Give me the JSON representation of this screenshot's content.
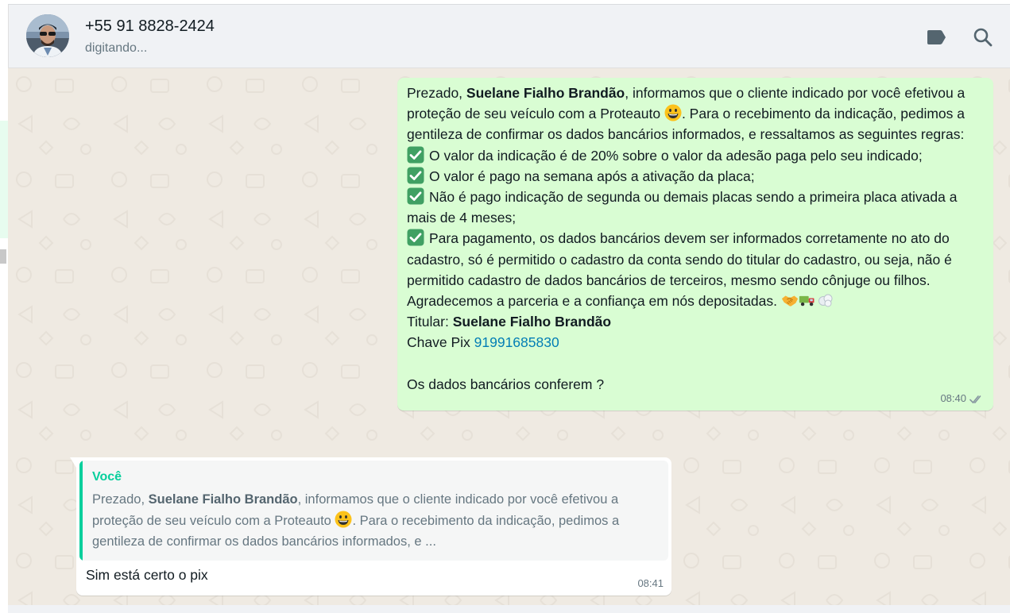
{
  "header": {
    "contact_name": "+55 91 8828-2424",
    "status": "digitando...",
    "icons": [
      "label-icon",
      "search-icon"
    ]
  },
  "colors": {
    "header_bg": "#f0f2f5",
    "chat_bg": "#efeae2",
    "outgoing_bubble": "#d9fdd3",
    "incoming_bubble": "#ffffff",
    "quote_accent": "#06cf9c",
    "link": "#027eb5",
    "read_ticks": "#8696a0"
  },
  "outgoing_message": {
    "intro_prefix": "Prezado, ",
    "intro_name": "Suelane Fialho Brandão",
    "intro_mid": ", informamos que o cliente indicado por você efetivou a proteção de seu veículo com a Proteauto ",
    "intro_suffix": ". Para o recebimento da indicação, pedimos a gentileza de confirmar os dados bancários informados, e ressaltamos as seguintes regras:",
    "rules": [
      "O valor da indicação é de 20% sobre o valor da adesão paga pelo seu indicado;",
      "O valor é pago na semana após a ativação da placa;",
      "Não é pago indicação de segunda ou demais placas sendo a primeira placa ativada a mais de 4 meses;",
      "Para pagamento, os dados bancários devem ser informados corretamente no ato do cadastro, só é permitido o cadastro da conta sendo do titular do cadastro, ou seja, não é permitido cadastro de dados bancários de terceiros, mesmo sendo cônjuge ou filhos."
    ],
    "thanks": "Agradecemos a parceria e a confiança em nós depositadas.",
    "holder_label": "Titular:",
    "holder_name": "Suelane Fialho Brandão",
    "pix_label": "Chave Pix",
    "pix_key": "91991685830",
    "question": "Os dados bancários conferem ?",
    "time": "08:40",
    "status": "read"
  },
  "incoming_message": {
    "quote_author": "Você",
    "quote_prefix": "Prezado, ",
    "quote_name": "Suelane Fialho Brandão",
    "quote_mid": ", informamos que o cliente indicado por você efetivou a proteção de seu veículo com a Proteauto ",
    "quote_suffix": ". Para o recebimento da indicação, pedimos a gentileza de confirmar os dados bancários informados, e ...",
    "text": "Sim está certo o pix",
    "time": "08:41"
  }
}
